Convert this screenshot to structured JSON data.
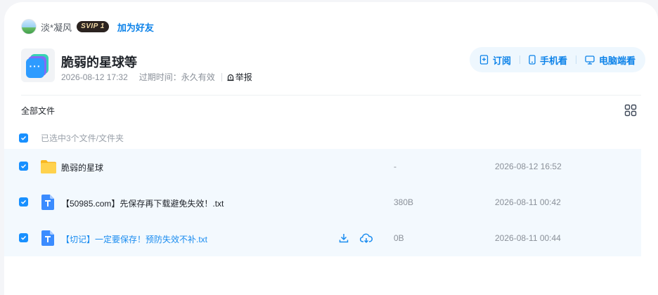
{
  "user": {
    "name": "淡*凝风",
    "badge": "SVIP 1",
    "add_friend": "加为好友"
  },
  "share": {
    "title": "脆弱的星球等",
    "date": "2026-08-12 17:32",
    "expiry": "过期时间：永久有效",
    "report": "举报"
  },
  "actions": {
    "subscribe": "订阅",
    "mobile": "手机看",
    "pc": "电脑端看"
  },
  "list": {
    "header": "全部文件",
    "selected_text": "已选中3个文件/文件夹",
    "files": [
      {
        "name": "脆弱的星球",
        "size": "-",
        "time": "2026-08-12 16:52",
        "type": "folder"
      },
      {
        "name": "【50985.com】先保存再下载避免失效！.txt",
        "size": "380B",
        "time": "2026-08-11 00:42",
        "type": "txt"
      },
      {
        "name": "【切记】一定要保存！预防失效不补.txt",
        "size": "0B",
        "time": "2026-08-11 00:44",
        "type": "txt"
      }
    ]
  },
  "colors": {
    "accent": "#0c82e9",
    "checkbox": "#1890ff",
    "row_bg": "#f3f9fe",
    "actions_bg": "#eef7fe"
  }
}
